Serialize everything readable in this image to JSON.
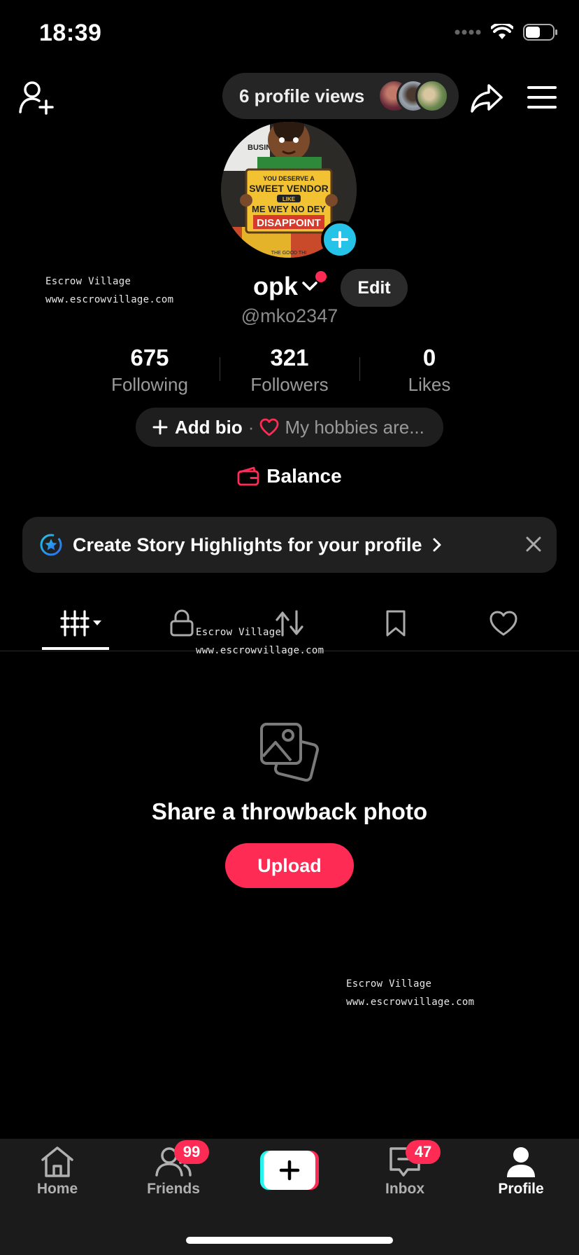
{
  "status_bar": {
    "time": "18:39"
  },
  "header": {
    "profile_views_label": "6 profile views"
  },
  "profile": {
    "name": "opk",
    "handle": "@mko2347",
    "edit_label": "Edit",
    "avatar_sign_lines": [
      "YOU DESERVE A",
      "SWEET VENDOR",
      "LIKE",
      "ME WEY NO DEY",
      "DISAPPOINT"
    ],
    "avatar_top_text": "BUSINESS",
    "avatar_bottom_text": "THE GOOD THI"
  },
  "stats": [
    {
      "value": "675",
      "label": "Following"
    },
    {
      "value": "321",
      "label": "Followers"
    },
    {
      "value": "0",
      "label": "Likes"
    }
  ],
  "bio": {
    "add_label": "Add bio",
    "separator": "·",
    "hint": "My hobbies are..."
  },
  "balance_label": "Balance",
  "highlights_banner": {
    "text": "Create Story Highlights for your profile"
  },
  "watermarks": [
    {
      "line1": "Escrow Village",
      "line2": "www.escrowvillage.com"
    },
    {
      "line1": "Escrow Village",
      "line2": "www.escrowvillage.com"
    },
    {
      "line1": "Escrow Village",
      "line2": "www.escrowvillage.com"
    }
  ],
  "empty_state": {
    "title": "Share a throwback photo",
    "button": "Upload"
  },
  "bottom_nav": [
    {
      "label": "Home"
    },
    {
      "label": "Friends",
      "badge": "99"
    },
    {
      "label": ""
    },
    {
      "label": "Inbox",
      "badge": "47"
    },
    {
      "label": "Profile"
    }
  ],
  "colors": {
    "accent": "#fe2c55",
    "cyan": "#25c3e8",
    "background": "#000000"
  }
}
